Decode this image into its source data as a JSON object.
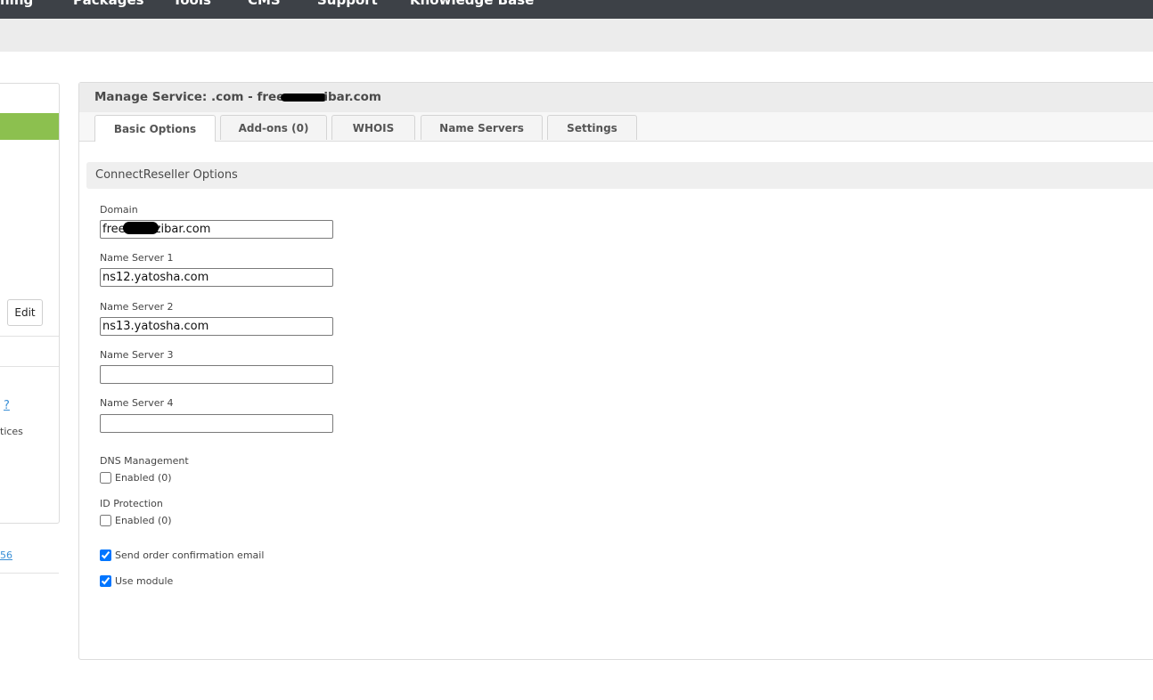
{
  "top_nav": {
    "items": [
      "ning",
      "Packages",
      "Tools",
      "CMS",
      "Support",
      "Knowledge Base"
    ]
  },
  "left": {
    "edit_label": "Edit",
    "help_label": "?",
    "text_fragment": "tices",
    "link_fragment": "56"
  },
  "panel": {
    "title_prefix": "Manage Service: .com - free",
    "title_suffix": "ibar.com",
    "tabs": [
      "Basic Options",
      "Add-ons (0)",
      "WHOIS",
      "Name Servers",
      "Settings"
    ],
    "active_tab": "Basic Options"
  },
  "section": {
    "title": "ConnectReseller Options"
  },
  "form": {
    "domain": {
      "label": "Domain",
      "value": "free        zibar.com"
    },
    "ns1": {
      "label": "Name Server 1",
      "value": "ns12.yatosha.com"
    },
    "ns2": {
      "label": "Name Server 2",
      "value": "ns13.yatosha.com"
    },
    "ns3": {
      "label": "Name Server 3",
      "value": ""
    },
    "ns4": {
      "label": "Name Server 4",
      "value": ""
    },
    "dns": {
      "label": "DNS Management",
      "option": "Enabled (0)",
      "checked": false
    },
    "idp": {
      "label": "ID Protection",
      "option": "Enabled (0)",
      "checked": false
    },
    "send_email": {
      "label": "Send order confirmation email",
      "checked": true
    },
    "use_module": {
      "label": "Use module",
      "checked": true
    }
  },
  "colors": {
    "nav_bg": "#3d4147",
    "accent_green": "#8cc04f",
    "link_blue": "#3a8fd6"
  }
}
